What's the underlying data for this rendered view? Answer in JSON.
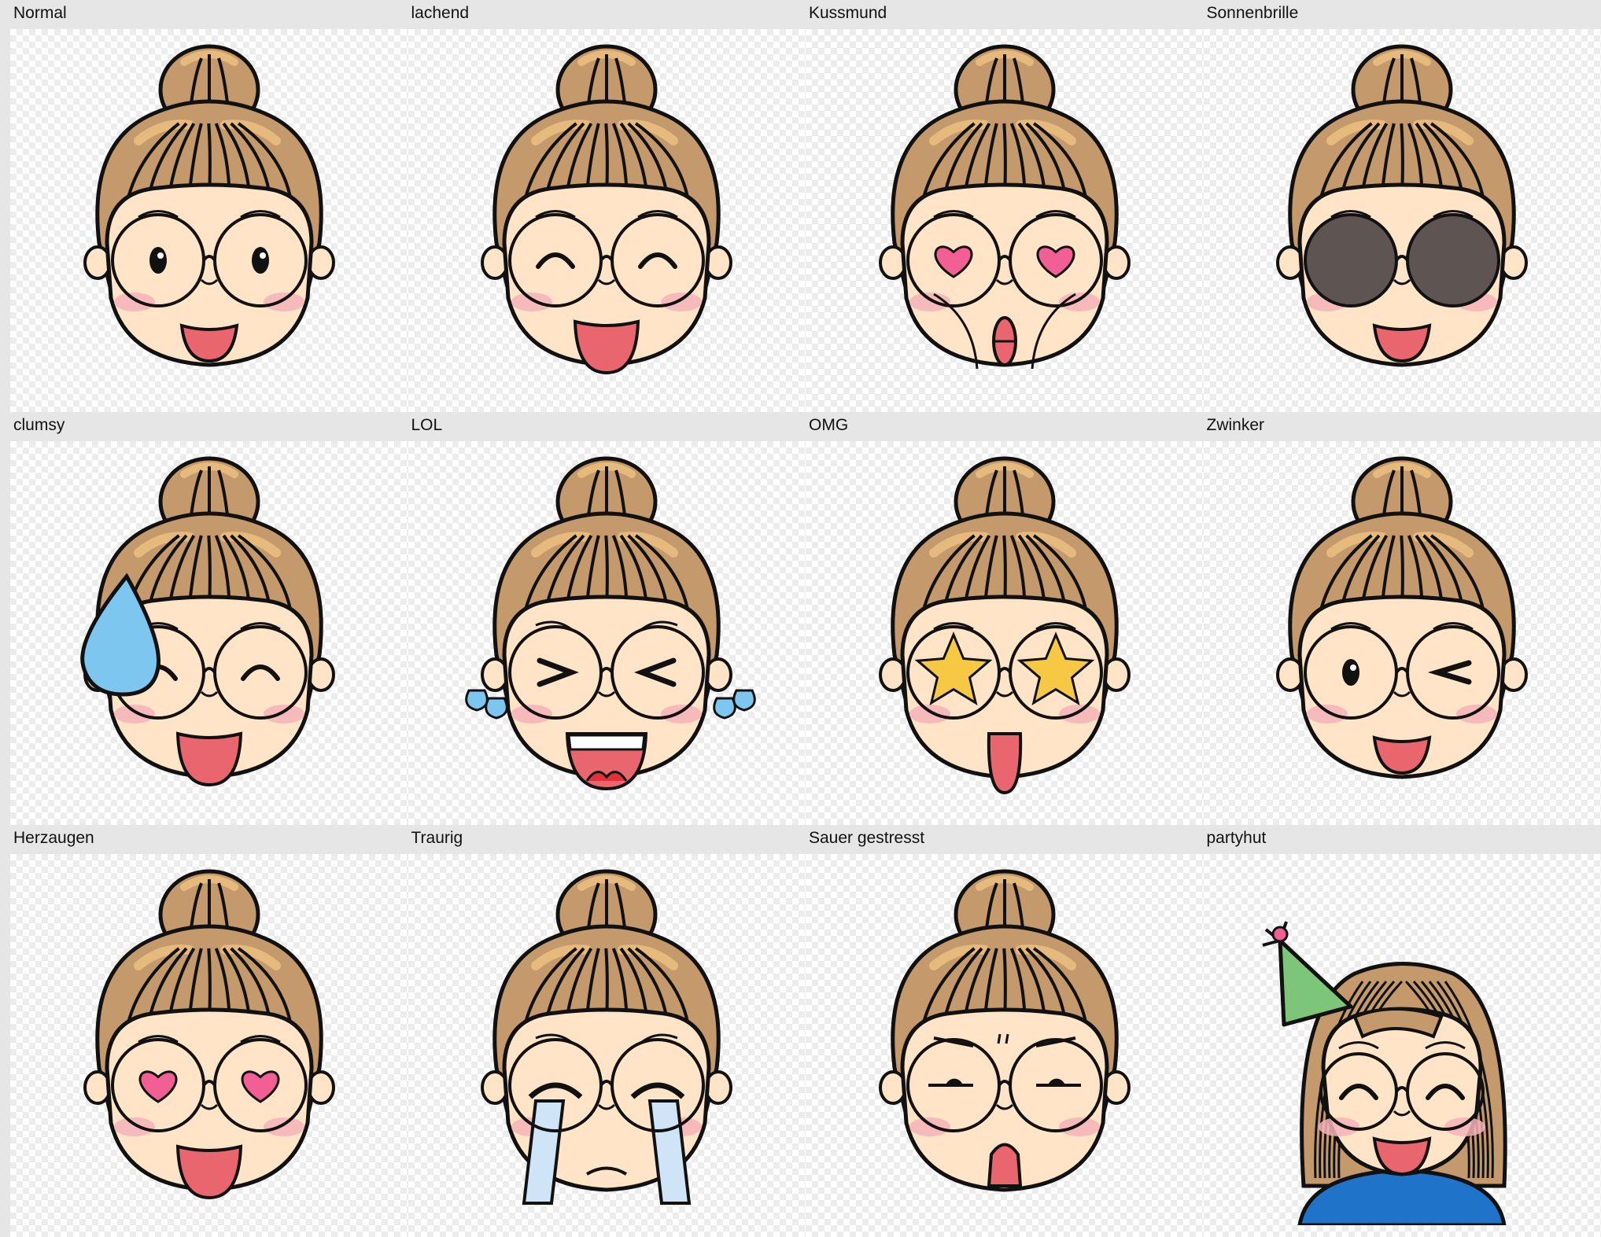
{
  "colors": {
    "hair": "#c49a6c",
    "hair_highlight": "#e6b97c",
    "skin": "#ffe4c8",
    "blush": "#f6b3b9",
    "outline": "#111111",
    "mouth": "#e9666f",
    "heart": "#f25f95",
    "tear": "#7cc6f0",
    "star": "#f7c843",
    "lens_dark": "#5e5552",
    "hat": "#7cc579",
    "shirt": "#1f73c9"
  },
  "emojis": [
    {
      "label": "Normal",
      "eyes": "dot",
      "mouth": "open",
      "extra": "none",
      "hair": "bun"
    },
    {
      "label": "lachend",
      "eyes": "happy",
      "mouth": "bigopen",
      "extra": "none",
      "hair": "bun"
    },
    {
      "label": "Kussmund",
      "eyes": "heart",
      "mouth": "kiss",
      "extra": "none",
      "hair": "bun"
    },
    {
      "label": "Sonnenbrille",
      "eyes": "shades",
      "mouth": "open",
      "extra": "none",
      "hair": "bun"
    },
    {
      "label": "clumsy",
      "eyes": "happy",
      "mouth": "bigopen",
      "extra": "sweat",
      "hair": "bun"
    },
    {
      "label": "LOL",
      "eyes": "xd",
      "mouth": "laugh",
      "extra": "tears",
      "hair": "bun"
    },
    {
      "label": "OMG",
      "eyes": "star",
      "mouth": "oval",
      "extra": "none",
      "hair": "bun"
    },
    {
      "label": "Zwinker",
      "eyes": "wink",
      "mouth": "open",
      "extra": "none",
      "hair": "bun"
    },
    {
      "label": "Herzaugen",
      "eyes": "heart",
      "mouth": "bigopen",
      "extra": "none",
      "hair": "bun"
    },
    {
      "label": "Traurig",
      "eyes": "cry",
      "mouth": "sad",
      "extra": "none",
      "hair": "bun"
    },
    {
      "label": "Sauer gestresst",
      "eyes": "angry",
      "mouth": "small",
      "extra": "none",
      "hair": "bun"
    },
    {
      "label": "partyhut",
      "eyes": "happy",
      "mouth": "open",
      "extra": "none",
      "hair": "long"
    }
  ]
}
